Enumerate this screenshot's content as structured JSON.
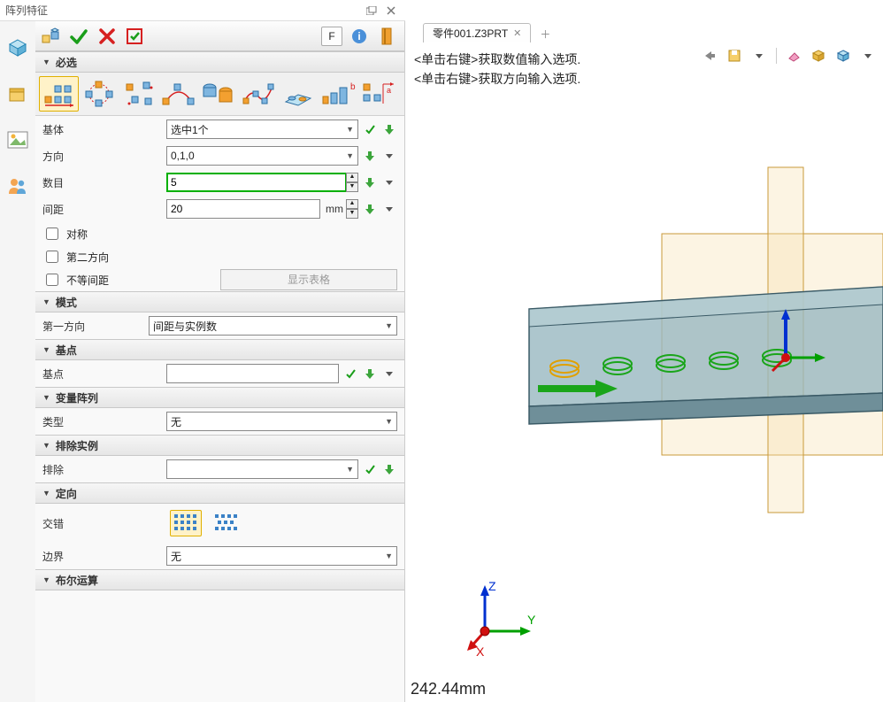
{
  "panel": {
    "title": "阵列特征"
  },
  "cmd": {
    "F": "F"
  },
  "sections": {
    "required": "必选",
    "mode": "模式",
    "basept": "基点",
    "varpattern": "变量阵列",
    "exclude": "排除实例",
    "orient": "定向",
    "boolean": "布尔运算"
  },
  "fields": {
    "base_label": "基体",
    "base_value": "选中1个",
    "dir_label": "方向",
    "dir_value": "0,1,0",
    "count_label": "数目",
    "count_value": "5",
    "spacing_label": "间距",
    "spacing_value": "20",
    "spacing_unit": "mm",
    "sym": "对称",
    "second_dir": "第二方向",
    "unequal": "不等间距",
    "show_table": "显示表格",
    "first_dir_label": "第一方向",
    "first_dir_value": "间距与实例数",
    "basept_label": "基点",
    "type_label": "类型",
    "type_value": "无",
    "exclude_label": "排除",
    "stagger_label": "交错",
    "boundary_label": "边界",
    "boundary_value": "无"
  },
  "tab": {
    "filename": "零件001.Z3PRT"
  },
  "hints": {
    "line1": "<单击右键>获取数值输入选项.",
    "line2": "<单击右键>获取方向输入选项."
  },
  "status": {
    "mm": "242.44mm"
  },
  "axes": {
    "x": "X",
    "y": "Y",
    "z": "Z"
  }
}
